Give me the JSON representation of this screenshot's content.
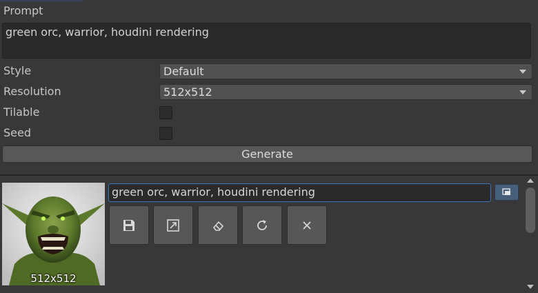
{
  "form": {
    "prompt_label": "Prompt",
    "prompt_value": "green orc, warrior, houdini rendering",
    "style_label": "Style",
    "style_value": "Default",
    "resolution_label": "Resolution",
    "resolution_value": "512x512",
    "tilable_label": "Tilable",
    "tilable_checked": false,
    "seed_label": "Seed",
    "seed_checked": false,
    "generate_label": "Generate"
  },
  "result": {
    "thumbnail_caption": "512x512",
    "prompt_value": "green orc, warrior, houdini rendering",
    "copy_icon": "copy-window-icon",
    "actions": [
      {
        "name": "save",
        "icon": "floppy-disk-icon"
      },
      {
        "name": "upscale",
        "icon": "expand-arrow-icon"
      },
      {
        "name": "erase",
        "icon": "eraser-icon"
      },
      {
        "name": "regenerate",
        "icon": "refresh-icon"
      },
      {
        "name": "remove",
        "icon": "close-icon"
      }
    ]
  },
  "colors": {
    "background": "#383838",
    "field": "#2a2a2a",
    "button": "#575757",
    "focus_border": "#3a79bb",
    "copy_button": "#46607c"
  }
}
